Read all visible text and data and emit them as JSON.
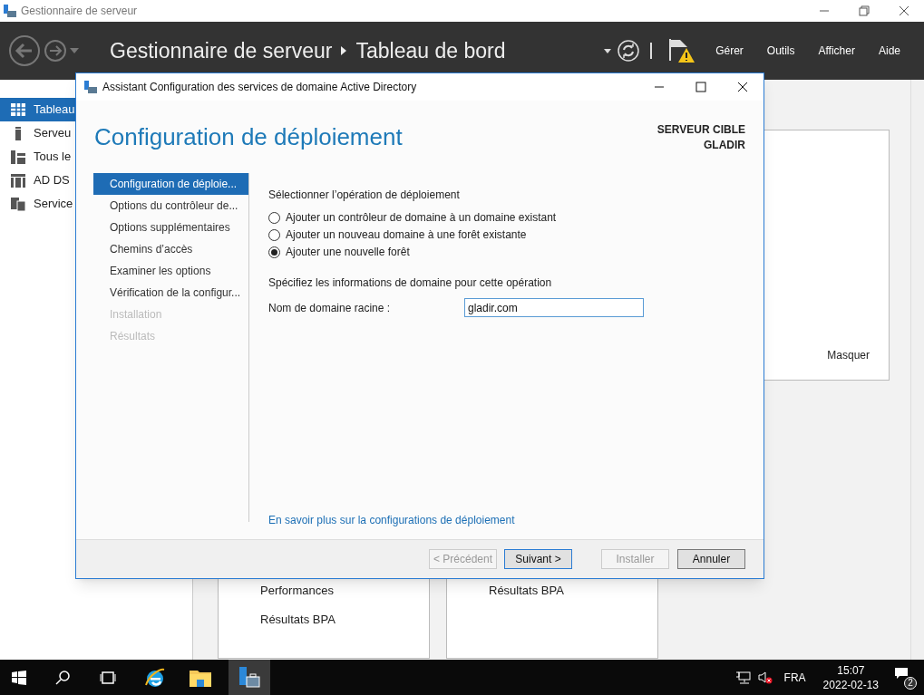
{
  "window": {
    "title": "Gestionnaire de serveur"
  },
  "header": {
    "breadcrumb": [
      "Gestionnaire de serveur",
      "Tableau de bord"
    ],
    "menus": [
      "Gérer",
      "Outils",
      "Afficher",
      "Aide"
    ]
  },
  "sidebar": {
    "items": [
      {
        "label": "Tableau",
        "selected": true
      },
      {
        "label": "Serveu",
        "selected": false
      },
      {
        "label": "Tous le",
        "selected": false
      },
      {
        "label": "AD DS",
        "selected": false
      },
      {
        "label": "Service",
        "selected": false
      }
    ]
  },
  "welcome_panel": {
    "hide_link": "Masquer"
  },
  "tiles": [
    {
      "items": [
        "Performances",
        "Résultats BPA"
      ]
    },
    {
      "items": [
        "Résultats BPA"
      ]
    }
  ],
  "dialog": {
    "title": "Assistant Configuration des services de domaine Active Directory",
    "heading": "Configuration de déploiement",
    "target_label": "SERVEUR CIBLE",
    "target_name": "GLADIR",
    "steps": [
      {
        "label": "Configuration de déploie...",
        "selected": true,
        "disabled": false
      },
      {
        "label": "Options du contrôleur de...",
        "selected": false,
        "disabled": false
      },
      {
        "label": "Options supplémentaires",
        "selected": false,
        "disabled": false
      },
      {
        "label": "Chemins d’accès",
        "selected": false,
        "disabled": false
      },
      {
        "label": "Examiner les options",
        "selected": false,
        "disabled": false
      },
      {
        "label": "Vérification de la configur...",
        "selected": false,
        "disabled": false
      },
      {
        "label": "Installation",
        "selected": false,
        "disabled": true
      },
      {
        "label": "Résultats",
        "selected": false,
        "disabled": true
      }
    ],
    "operation_label": "Sélectionner l’opération de déploiement",
    "options": [
      {
        "label": "Ajouter un contrôleur de domaine à un domaine existant",
        "selected": false
      },
      {
        "label": "Ajouter un nouveau domaine à une forêt existante",
        "selected": false
      },
      {
        "label": "Ajouter une nouvelle forêt",
        "selected": true
      }
    ],
    "domain_label": "Spécifiez les informations de domaine pour cette opération",
    "field": {
      "label": "Nom de domaine racine :",
      "value": "gladir.com"
    },
    "link": "En savoir plus sur la configurations de déploiement",
    "buttons": [
      {
        "label": "< Précédent",
        "disabled": true,
        "default": false
      },
      {
        "label": "Suivant >",
        "disabled": false,
        "default": true
      },
      {
        "label": "Installer",
        "disabled": true,
        "default": false
      },
      {
        "label": "Annuler",
        "disabled": false,
        "default": false
      }
    ]
  },
  "taskbar": {
    "language": "FRA",
    "time": "15:07",
    "date": "2022-02-13",
    "notifications": "2"
  }
}
